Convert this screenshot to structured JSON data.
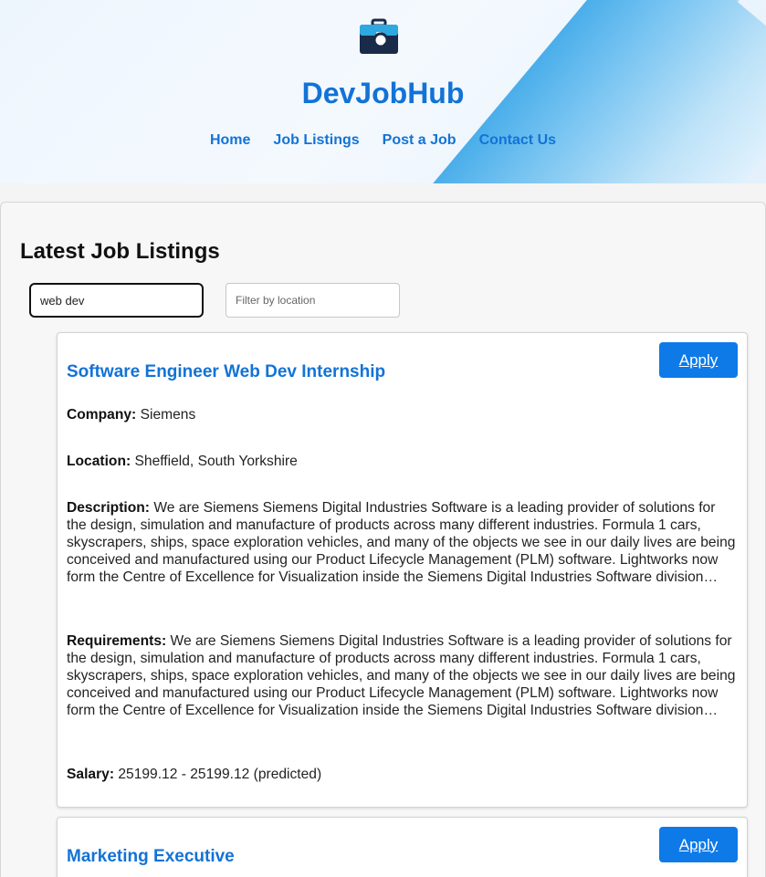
{
  "header": {
    "brand": "DevJobHub",
    "logo_icon": "briefcase-search-icon",
    "nav": [
      "Home",
      "Job Listings",
      "Post a Job",
      "Contact Us"
    ]
  },
  "main": {
    "title": "Latest Job Listings",
    "search": {
      "value": "web dev",
      "placeholder": ""
    },
    "location": {
      "value": "",
      "placeholder": "Filter by location"
    }
  },
  "jobs": [
    {
      "title": "Software Engineer Web Dev Internship",
      "apply_label": "Apply",
      "company_label": "Company:",
      "company": "Siemens",
      "location_label": "Location:",
      "location": "Sheffield, South Yorkshire",
      "description_label": "Description:",
      "description": "We are Siemens Siemens Digital Industries Software is a leading provider of solutions for the design, simulation and manufacture of products across many different industries. Formula 1 cars, skyscrapers, ships, space exploration vehicles, and many of the objects we see in our daily lives are being conceived and manufactured using our Product Lifecycle Management (PLM) software. Lightworks now form the Centre of Excellence for Visualization inside the Siemens Digital Industries Software division…",
      "requirements_label": "Requirements:",
      "requirements": "We are Siemens Siemens Digital Industries Software is a leading provider of solutions for the design, simulation and manufacture of products across many different industries. Formula 1 cars, skyscrapers, ships, space exploration vehicles, and many of the objects we see in our daily lives are being conceived and manufactured using our Product Lifecycle Management (PLM) software. Lightworks now form the Centre of Excellence for Visualization inside the Siemens Digital Industries Software division…",
      "salary_label": "Salary:",
      "salary": "25199.12 - 25199.12 (predicted)"
    },
    {
      "title": "Marketing Executive",
      "apply_label": "Apply"
    }
  ],
  "colors": {
    "accent": "#1273d6",
    "button": "#0d7ae8"
  }
}
